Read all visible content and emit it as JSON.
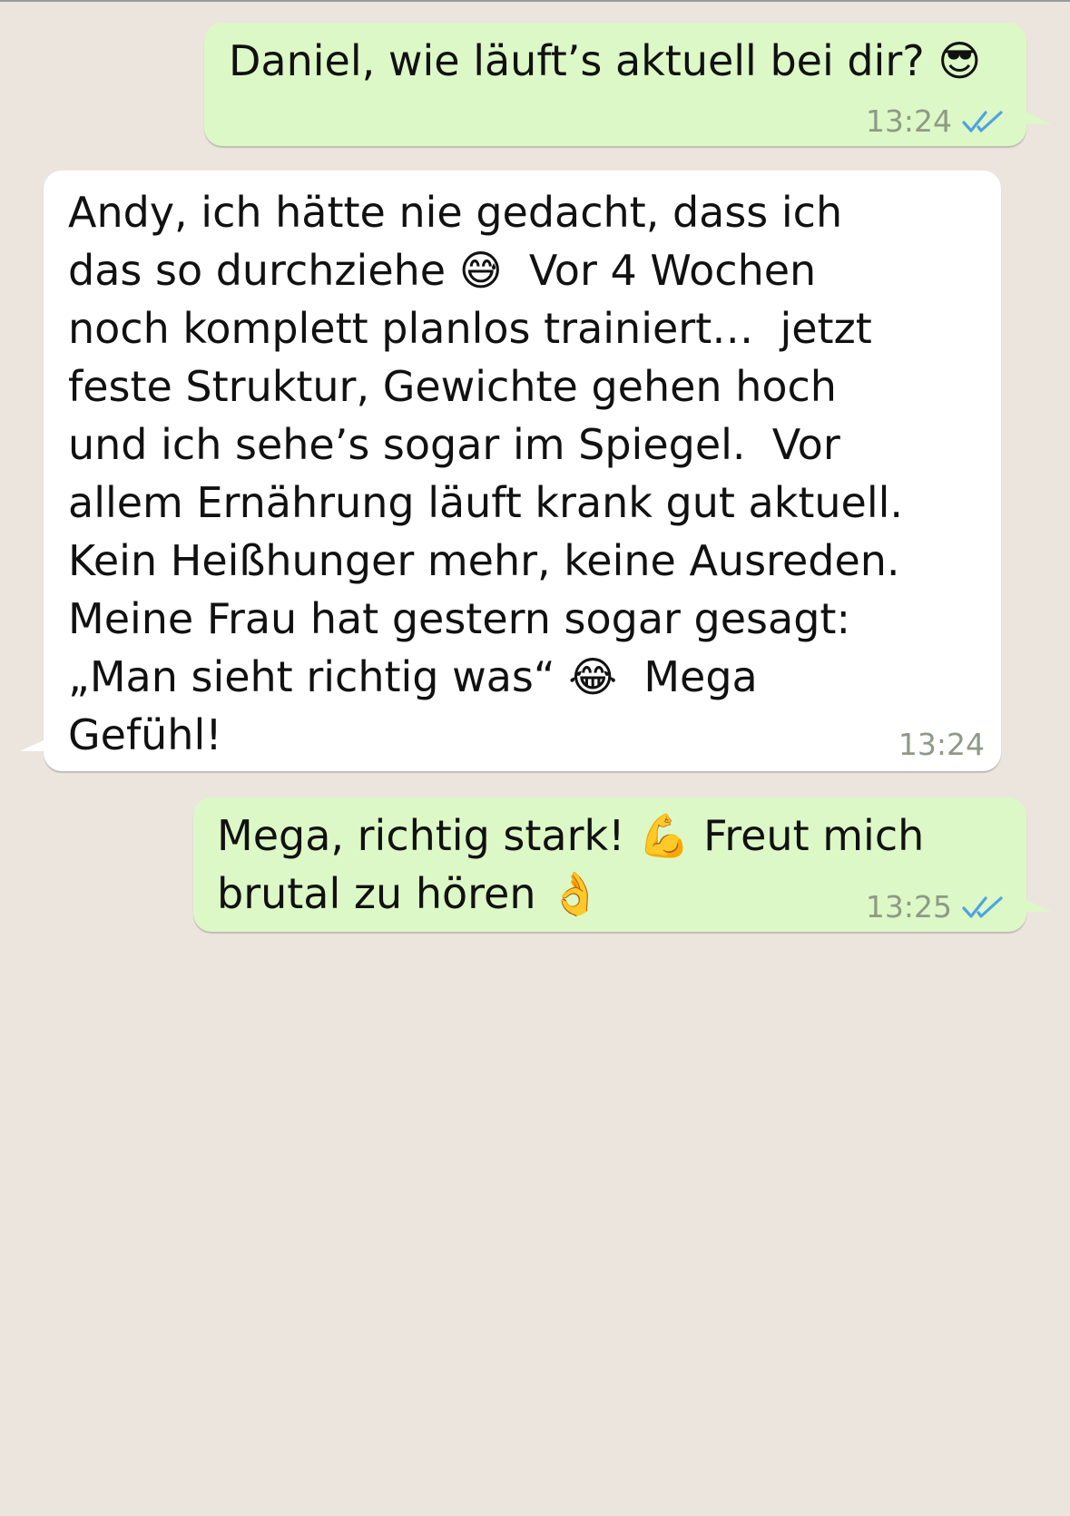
{
  "messages": [
    {
      "direction": "outgoing",
      "lines": [
        "Daniel, wie läuft’s aktuell bei dir? 😎"
      ],
      "time": "13:24",
      "status_icon": "double-check-read-icon"
    },
    {
      "direction": "incoming",
      "lines": [
        "Andy, ich hätte nie gedacht, dass ich",
        "das so durchziehe 😅  Vor 4 Wochen",
        "noch komplett planlos trainiert…  jetzt",
        "feste Struktur, Gewichte gehen hoch",
        "und ich sehe’s sogar im Spiegel.  Vor",
        "allem Ernährung läuft krank gut aktuell.",
        "Kein Heißhunger mehr, keine Ausreden.",
        "Meine Frau hat gestern sogar gesagt:",
        "„Man sieht richtig was“ 😂  Mega",
        "Gefühl!"
      ],
      "time": "13:24"
    },
    {
      "direction": "outgoing",
      "lines": [
        "Mega, richtig stark! 💪 Freut mich",
        "brutal zu hören 👌"
      ],
      "time": "13:25",
      "status_icon": "double-check-read-icon"
    }
  ],
  "colors": {
    "background": "#ece5dd",
    "outgoing_bubble": "#dcf8c6",
    "incoming_bubble": "#ffffff",
    "read_ticks": "#4fa3e0",
    "timestamp": "#8e9a86"
  }
}
